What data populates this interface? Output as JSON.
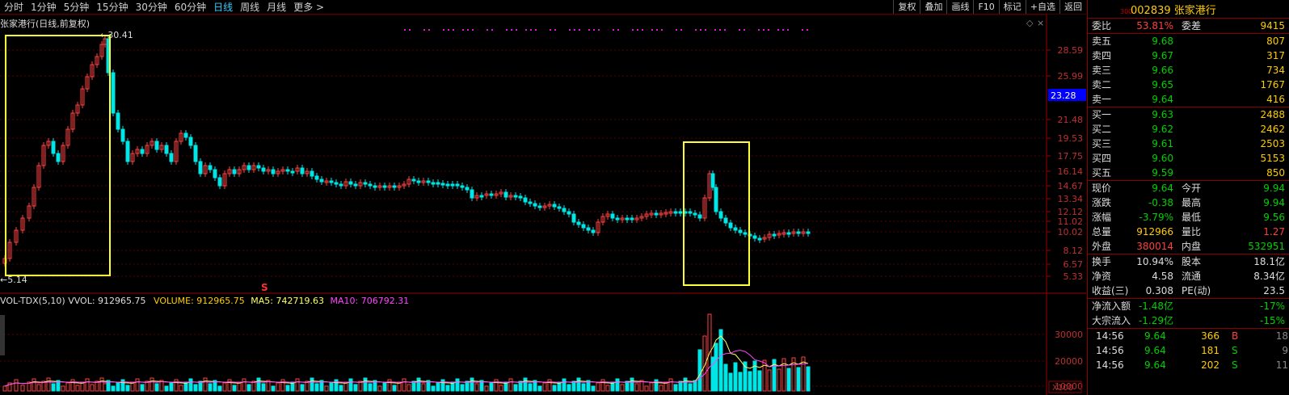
{
  "periods": [
    "分时",
    "1分钟",
    "5分钟",
    "15分钟",
    "30分钟",
    "60分钟",
    "日线",
    "周线",
    "月线",
    "更多 >"
  ],
  "active_period": "日线",
  "toolbar": [
    "复权",
    "叠加",
    "画线",
    "F10",
    "标记",
    "+自选",
    "返回"
  ],
  "chart": {
    "title": "张家港行(日线,前复权)",
    "high_label": "30.41",
    "low_label": "5.14",
    "price_ticks": [
      "28.59",
      "25.99",
      "21.48",
      "19.53",
      "17.75",
      "16.14",
      "14.67",
      "13.34",
      "12.12",
      "11.02",
      "10.02",
      "8.12",
      "6.57",
      "5.33"
    ],
    "current_price": "23.28",
    "current_price_color": "#0000ff",
    "marker": "S",
    "vol_ticks": [
      "30000",
      "20000",
      "10000"
    ],
    "vol_unit": "X100",
    "vol_title": {
      "name": "VOL-TDX(5,10)",
      "vvol": "VVOL: 912965.75",
      "volume": "VOLUME: 912965.75",
      "ma5": "MA5: 742719.63",
      "ma10": "MA10: 706792.31"
    },
    "up_color": "#ff4040",
    "down_color": "#00e5e5",
    "highlight_color": "#ffff33"
  },
  "quote": {
    "market": "300",
    "code": "002839",
    "name": "张家港行",
    "weibi_label": "委比",
    "weibi": "53.81%",
    "weicha_label": "委差",
    "weicha": "9415",
    "asks": [
      {
        "label": "卖五",
        "price": "9.68",
        "vol": "807"
      },
      {
        "label": "卖四",
        "price": "9.67",
        "vol": "317"
      },
      {
        "label": "卖三",
        "price": "9.66",
        "vol": "734"
      },
      {
        "label": "卖二",
        "price": "9.65",
        "vol": "1767"
      },
      {
        "label": "卖一",
        "price": "9.64",
        "vol": "416"
      }
    ],
    "bids": [
      {
        "label": "买一",
        "price": "9.63",
        "vol": "2488"
      },
      {
        "label": "买二",
        "price": "9.62",
        "vol": "2462"
      },
      {
        "label": "买三",
        "price": "9.61",
        "vol": "2503"
      },
      {
        "label": "买四",
        "price": "9.60",
        "vol": "5153"
      },
      {
        "label": "买五",
        "price": "9.59",
        "vol": "850"
      }
    ],
    "stats": [
      {
        "l1": "现价",
        "v1": "9.64",
        "c1": "g",
        "l2": "今开",
        "v2": "9.94",
        "c2": "g"
      },
      {
        "l1": "涨跌",
        "v1": "-0.38",
        "c1": "g",
        "l2": "最高",
        "v2": "9.94",
        "c2": "g"
      },
      {
        "l1": "涨幅",
        "v1": "-3.79%",
        "c1": "g",
        "l2": "最低",
        "v2": "9.56",
        "c2": "g"
      },
      {
        "l1": "总量",
        "v1": "912966",
        "c1": "y",
        "l2": "量比",
        "v2": "1.27",
        "c2": "r"
      },
      {
        "l1": "外盘",
        "v1": "380014",
        "c1": "r",
        "l2": "内盘",
        "v2": "532951",
        "c2": "g"
      }
    ],
    "stats2": [
      {
        "l1": "换手",
        "v1": "10.94%",
        "l2": "股本",
        "v2": "18.1亿"
      },
      {
        "l1": "净资",
        "v1": "4.58",
        "l2": "流通",
        "v2": "8.34亿"
      },
      {
        "l1": "收益(三)",
        "v1": "0.308",
        "l2": "PE(动)",
        "v2": "23.5"
      }
    ],
    "flows": [
      {
        "label": "净流入额",
        "value": "-1.48亿",
        "pct": "-17%"
      },
      {
        "label": "大宗流入",
        "value": "-1.29亿",
        "pct": "-15%"
      }
    ],
    "ticks": [
      {
        "time": "14:56",
        "price": "9.64",
        "vol": "366",
        "side": "B",
        "num": "18"
      },
      {
        "time": "14:56",
        "price": "9.64",
        "vol": "181",
        "side": "S",
        "num": "9"
      },
      {
        "time": "14:56",
        "price": "9.64",
        "vol": "202",
        "side": "S",
        "num": "11"
      }
    ]
  }
}
